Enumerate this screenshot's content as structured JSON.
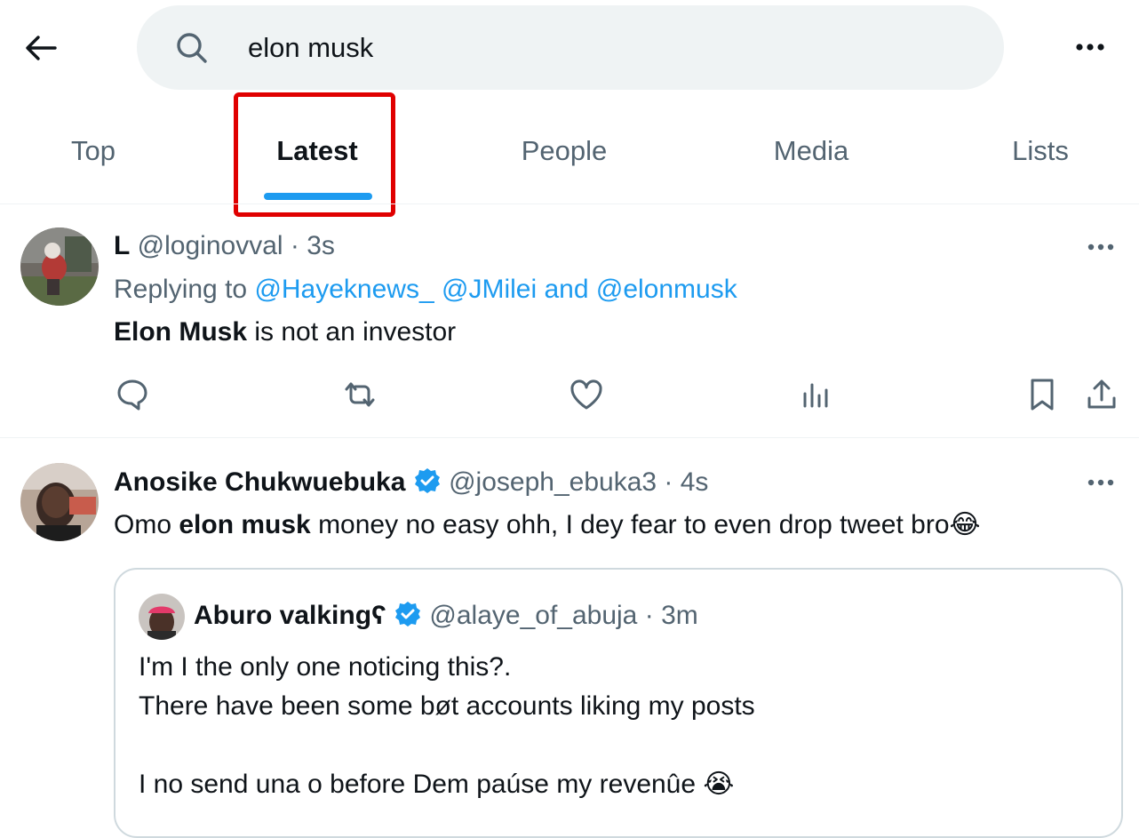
{
  "search": {
    "query": "elon musk"
  },
  "tabs": [
    {
      "label": "Top"
    },
    {
      "label": "Latest"
    },
    {
      "label": "People"
    },
    {
      "label": "Media"
    },
    {
      "label": "Lists"
    }
  ],
  "active_tab": "Latest",
  "colors": {
    "accent": "#1d9bf0",
    "highlight": "#e00000",
    "muted": "#536471",
    "verified": "#1d9bf0"
  },
  "tweets": [
    {
      "name": "L",
      "handle": "@loginovval",
      "separator": "·",
      "time": "3s",
      "replying_prefix": "Replying to",
      "replying_mentions": [
        "@Hayeknews_",
        "@JMilei",
        "and",
        "@elonmusk"
      ],
      "text_bold": "Elon Musk",
      "text_rest": " is not an investor"
    },
    {
      "name": "Anosike Chukwuebuka",
      "verified": true,
      "handle": "@joseph_ebuka3",
      "separator": "·",
      "time": "4s",
      "text_prefix": "Omo ",
      "text_bold": "elon musk",
      "text_rest": " money no easy ohh, I dey fear to even drop tweet bro",
      "emoji": "😂",
      "quote": {
        "name": "Aburo valking",
        "name_suffix": "ʕ",
        "verified": true,
        "handle": "@alaye_of_abuja",
        "separator": "·",
        "time": "3m",
        "lines": [
          "I'm I the only one noticing this?.",
          "There have been some bøt accounts liking my posts",
          "",
          "I no send una o before Dem paúse my revenûe"
        ],
        "emoji": "😭"
      }
    }
  ],
  "icons": [
    "back-arrow-icon",
    "search-icon",
    "more-icon",
    "reply-icon",
    "retweet-icon",
    "like-icon",
    "views-icon",
    "bookmark-icon",
    "share-icon",
    "verified-badge-icon"
  ]
}
